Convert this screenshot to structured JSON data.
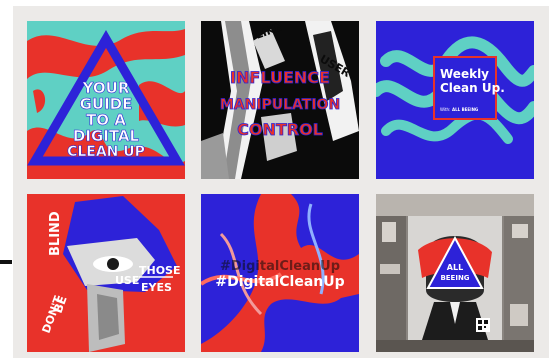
{
  "colors": {
    "frame_bg": "#eceae8",
    "teal": "#5fd0c4",
    "red": "#e8322a",
    "blue": "#2d22d8",
    "black": "#0b0b0b",
    "white": "#ffffff"
  },
  "tiles": [
    {
      "id": "guide",
      "lines": [
        "YOUR",
        "GUIDE",
        "TO A",
        "DIGITAL",
        "CLEAN UP"
      ]
    },
    {
      "id": "influence",
      "lines": [
        "INFLUENCE",
        "MANIPULATION",
        "CONTROL"
      ],
      "collage_labels": [
        "LIKE",
        "USER"
      ]
    },
    {
      "id": "weekly",
      "title_lines": [
        "Weekly",
        "Clean Up."
      ],
      "byline": "With:",
      "byline_brand": "ALL BEEING"
    },
    {
      "id": "dont-be-blind",
      "words": [
        "BLIND",
        "BE",
        "DON'T",
        "USE",
        "THOSE",
        "EYES"
      ]
    },
    {
      "id": "hashtag",
      "text": "#DigitalCleanUp",
      "echo_text": "#DigitalCleanUp"
    },
    {
      "id": "street-poster",
      "badge_lines": [
        "ALL",
        "BEEING"
      ]
    }
  ]
}
